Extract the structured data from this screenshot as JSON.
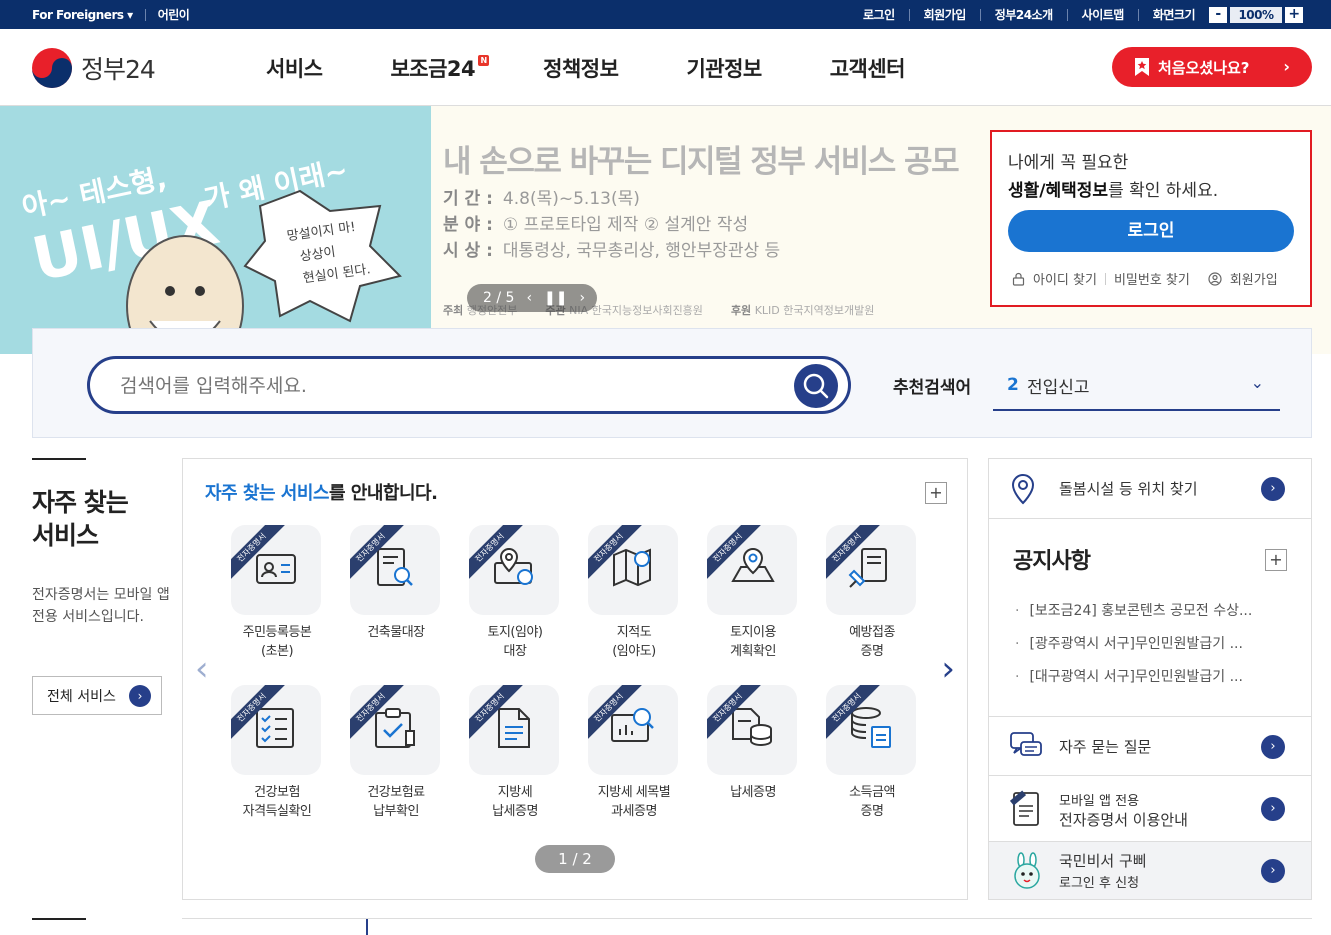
{
  "topbar": {
    "foreigners": "For Foreigners ▾",
    "kids": "어린이",
    "links": [
      "로그인",
      "회원가입",
      "정부24소개",
      "사이트맵",
      "화면크기"
    ],
    "zoom_minus": "-",
    "zoom_value": "100%",
    "zoom_plus": "+"
  },
  "header": {
    "logo_text": "정부24",
    "nav": [
      "서비스",
      "보조금24",
      "정책정보",
      "기관정보",
      "고객센터"
    ],
    "new_badge": "N",
    "first_visit": "처음오셨나요?"
  },
  "banner": {
    "title": "내 손으로 바꾸는 디지털 정부 서비스 공모",
    "period_label": "기 간 :",
    "period_value": "4.8(목)~5.13(목)",
    "field_label": "분 야 :",
    "field_value": "① 프로토타입 제작 ② 설계안 작성",
    "award_label": "시 상 :",
    "award_value": "대통령상, 국무총리상, 행안부장관상 등",
    "hero_line1": "아~ 테스형,",
    "hero_line2": "UI/UX",
    "hero_line3": "가 왜 이래~",
    "bubble": "망설이지 마! 상상이 현실이 된다.",
    "pager": "2 / 5",
    "sponsor1_label": "주최",
    "sponsor1": "행정안전부",
    "sponsor2_label": "주관",
    "sponsor2": "NIA 한국지능정보사회진흥원",
    "sponsor3_label": "후원",
    "sponsor3": "KLID 한국지역정보개발원"
  },
  "login": {
    "line1": "나에게 꼭 필요한",
    "line2_bold": "생활/혜택정보",
    "line2_rest": "를 확인 하세요.",
    "button": "로그인",
    "find_id": "아이디 찾기",
    "find_pw": "비밀번호 찾기",
    "signup": "회원가입"
  },
  "search": {
    "placeholder": "검색어를 입력해주세요.",
    "rec_label": "추천검색어",
    "rec_num": "2",
    "rec_value": "전입신고"
  },
  "freq": {
    "title_line1": "자주 찾는",
    "title_line2": "서비스",
    "desc": "전자증명서는 모바일 앱 전용 서비스입니다.",
    "all_button": "전체 서비스",
    "panel_title_hl": "자주 찾는 서비스",
    "panel_title_rest": "를 안내합니다.",
    "ribbon": "전자증명서",
    "items": [
      {
        "l1": "주민등록등본",
        "l2": "(초본)",
        "icon": "id-card-icon"
      },
      {
        "l1": "건축물대장",
        "l2": "",
        "icon": "document-search-icon"
      },
      {
        "l1": "토지(임야)",
        "l2": "대장",
        "icon": "land-location-icon"
      },
      {
        "l1": "지적도",
        "l2": "(임야도)",
        "icon": "map-search-icon"
      },
      {
        "l1": "토지이용",
        "l2": "계획확인",
        "icon": "map-pin-icon"
      },
      {
        "l1": "예방접종",
        "l2": "증명",
        "icon": "syringe-icon"
      },
      {
        "l1": "건강보험",
        "l2": "자격득실확인",
        "icon": "checklist-icon"
      },
      {
        "l1": "건강보험료",
        "l2": "납부확인",
        "icon": "clipboard-check-icon"
      },
      {
        "l1": "지방세",
        "l2": "납세증명",
        "icon": "document-icon"
      },
      {
        "l1": "지방세 세목별",
        "l2": "과세증명",
        "icon": "chart-board-icon"
      },
      {
        "l1": "납세증명",
        "l2": "",
        "icon": "coins-document-icon"
      },
      {
        "l1": "소득금액",
        "l2": "증명",
        "icon": "coins-stack-icon"
      }
    ],
    "pager": "1 / 2"
  },
  "right": {
    "location": "돌봄시설 등 위치 찾기",
    "notice_title": "공지사항",
    "notices": [
      "[보조금24] 홍보콘텐츠 공모전 수상...",
      "[광주광역시 서구]무인민원발급기 ...",
      "[대구광역시 서구]무인민원발급기 ..."
    ],
    "faq": "자주 묻는 질문",
    "mobile_l1": "모바일 앱 전용",
    "mobile_l2": "전자증명서 이용안내",
    "gubbi_l1": "국민비서 구삐",
    "gubbi_l2": "로그인 후 신청"
  },
  "colors": {
    "navy": "#0b2f6b",
    "primary": "#263f8a",
    "blue": "#1a74d1",
    "red": "#e8202a"
  }
}
